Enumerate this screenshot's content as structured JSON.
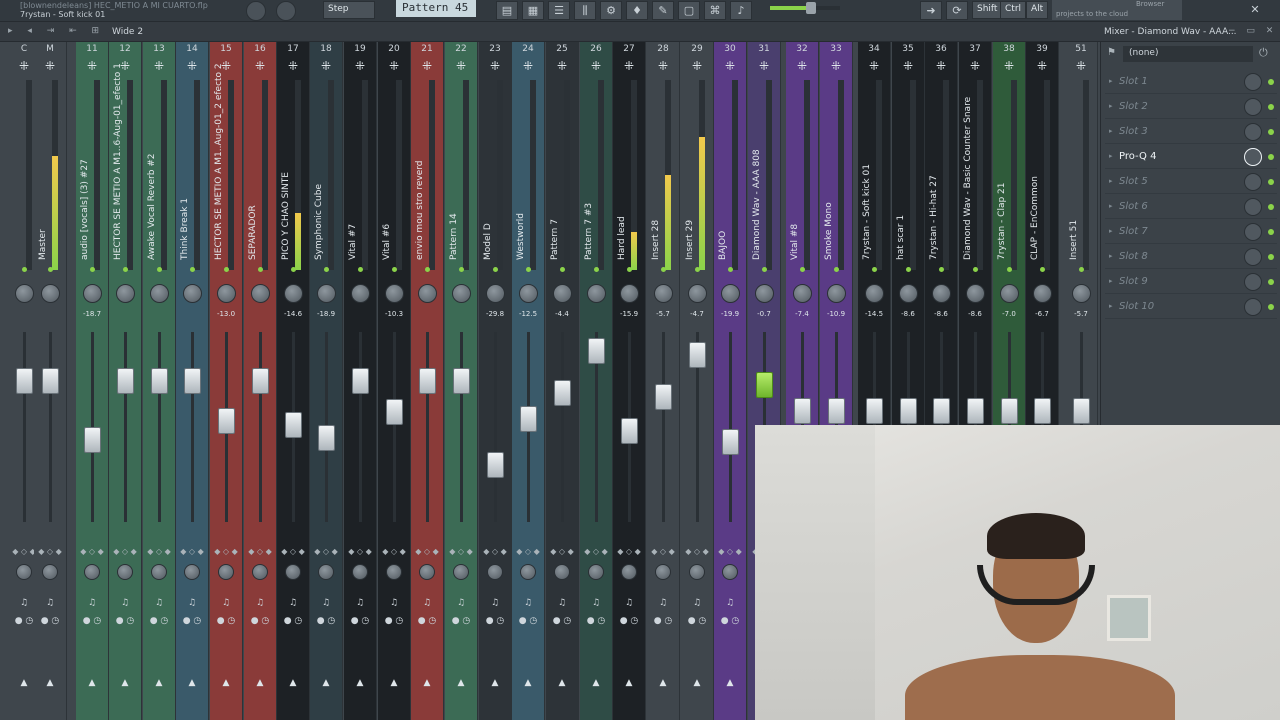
{
  "app": {
    "title": "[blownendeleans] HEC_METIO A MI CUARTO.flp",
    "subtitle": "7rystan - Soft kick 01"
  },
  "toolbar": {
    "step_label": "Step",
    "pattern_label": "Pattern 45",
    "shift_label": "Shift",
    "ctrl_label": "Ctrl",
    "alt_label": "Alt",
    "hint_text": "projects to the cloud",
    "browser_label": "Browser"
  },
  "subbar": {
    "wide_label": "Wide 2",
    "mixer_title": "Mixer - Diamond Wav - AAA..."
  },
  "db_scale": [
    "3",
    "0",
    "3",
    "6",
    "9",
    "12",
    "15",
    "18",
    "21",
    "24",
    "27",
    "30",
    "33"
  ],
  "strips": [
    {
      "num": "C",
      "name": "",
      "db": "",
      "fader": 0.74,
      "meter": 0
    },
    {
      "num": "M",
      "name": "Master",
      "db": "",
      "fader": 0.74,
      "meter": 0.6
    },
    {
      "num": "11",
      "name": "audio [vocals] (3) #27",
      "db": "-18.7",
      "fader": 0.43,
      "meter": 0
    },
    {
      "num": "12",
      "name": "HECTOR SE METIO A M1..6-Aug-01_efecto 1",
      "db": "",
      "fader": 0.74,
      "meter": 0
    },
    {
      "num": "13",
      "name": "Awake Vocal Reverb #2",
      "db": "",
      "fader": 0.74,
      "meter": 0
    },
    {
      "num": "14",
      "name": "Think Break 1",
      "db": "",
      "fader": 0.74,
      "meter": 0
    },
    {
      "num": "15",
      "name": "HECTOR SE METIO A M1..Aug-01_2 efecto 2",
      "db": "-13.0",
      "fader": 0.53,
      "meter": 0
    },
    {
      "num": "16",
      "name": "SEPARADOR",
      "db": "",
      "fader": 0.74,
      "meter": 0
    },
    {
      "num": "17",
      "name": "PICO Y CHAO SINTE",
      "db": "-14.6",
      "fader": 0.51,
      "meter": 0.3
    },
    {
      "num": "18",
      "name": "Symphonic Cube",
      "db": "-18.9",
      "fader": 0.44,
      "meter": 0
    },
    {
      "num": "19",
      "name": "Vital #7",
      "db": "",
      "fader": 0.74,
      "meter": 0
    },
    {
      "num": "20",
      "name": "Vital #6",
      "db": "-10.3",
      "fader": 0.58,
      "meter": 0
    },
    {
      "num": "21",
      "name": "envio mou stro reverd",
      "db": "",
      "fader": 0.74,
      "meter": 0
    },
    {
      "num": "22",
      "name": "Pattern 14",
      "db": "",
      "fader": 0.74,
      "meter": 0
    },
    {
      "num": "23",
      "name": "Model D",
      "db": "-29.8",
      "fader": 0.3,
      "meter": 0
    },
    {
      "num": "24",
      "name": "Westworld",
      "db": "-12.5",
      "fader": 0.54,
      "meter": 0
    },
    {
      "num": "25",
      "name": "Pattern 7",
      "db": "-4.4",
      "fader": 0.68,
      "meter": 0
    },
    {
      "num": "26",
      "name": "Pattern 7 #3",
      "db": "",
      "fader": 0.9,
      "meter": 0
    },
    {
      "num": "27",
      "name": "Hard lead",
      "db": "-15.9",
      "fader": 0.48,
      "meter": 0.2
    },
    {
      "num": "28",
      "name": "Insert 28",
      "db": "-5.7",
      "fader": 0.66,
      "meter": 0.5
    },
    {
      "num": "29",
      "name": "Insert 29",
      "db": "-4.7",
      "fader": 0.88,
      "meter": 0.7
    },
    {
      "num": "30",
      "name": "BAJOO",
      "db": "-19.9",
      "fader": 0.42,
      "meter": 0
    },
    {
      "num": "31",
      "name": "Diamond Wav - AAA 808",
      "db": "-0.7",
      "fader": 0.72,
      "meter": 0
    },
    {
      "num": "32",
      "name": "Vital #8",
      "db": "-7.4",
      "fader": 0.0,
      "meter": 0
    },
    {
      "num": "33",
      "name": "Smoke Mono",
      "db": "-10.9",
      "fader": 0.0,
      "meter": 0
    },
    {
      "num": "34",
      "name": "7rystan - Soft kick 01",
      "db": "-14.5",
      "fader": 0.0,
      "meter": 0
    },
    {
      "num": "35",
      "name": "hat scar 1",
      "db": "-8.6",
      "fader": 0.0,
      "meter": 0
    },
    {
      "num": "36",
      "name": "7rystan - Hi-hat 27",
      "db": "-8.6",
      "fader": 0.0,
      "meter": 0
    },
    {
      "num": "37",
      "name": "Diamond Wav - Basic Counter Snare",
      "db": "-8.6",
      "fader": 0.0,
      "meter": 0
    },
    {
      "num": "38",
      "name": "7rystan - Clap 21",
      "db": "-7.0",
      "fader": 0.0,
      "meter": 0
    },
    {
      "num": "39",
      "name": "CLAP - EnCommon",
      "db": "-6.7",
      "fader": 0.0,
      "meter": 0
    },
    {
      "num": "51",
      "name": "Insert 51",
      "db": "-5.7",
      "fader": 0.0,
      "meter": 0
    }
  ],
  "fx": {
    "selected_preset": "(none)",
    "slots": [
      {
        "label": "Slot 1",
        "active": false
      },
      {
        "label": "Slot 2",
        "active": false
      },
      {
        "label": "Slot 3",
        "active": false
      },
      {
        "label": "Pro-Q 4",
        "active": true
      },
      {
        "label": "Slot 5",
        "active": false
      },
      {
        "label": "Slot 6",
        "active": false
      },
      {
        "label": "Slot 7",
        "active": false
      },
      {
        "label": "Slot 8",
        "active": false
      },
      {
        "label": "Slot 9",
        "active": false
      },
      {
        "label": "Slot 10",
        "active": false
      }
    ]
  },
  "colors": {
    "accent_green": "#8bd34a",
    "strip_red": "#8a3b39",
    "strip_purple": "#5a3b86",
    "strip_green": "#2f5b3a",
    "strip_dark": "#1d2125"
  }
}
